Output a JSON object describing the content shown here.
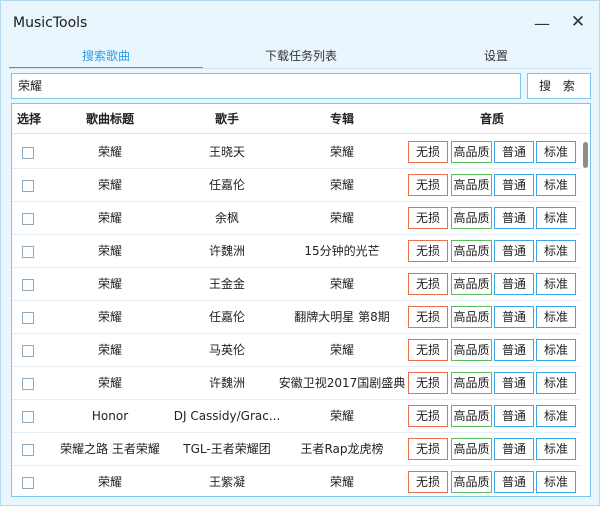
{
  "app": {
    "title": "MusicTools"
  },
  "window_controls": {
    "minimize": "—",
    "close": "✕"
  },
  "tabs": [
    {
      "label": "搜索歌曲"
    },
    {
      "label": "下载任务列表"
    },
    {
      "label": "设置"
    }
  ],
  "search": {
    "value": "荣耀",
    "button_label": "搜 索"
  },
  "columns": {
    "select": "选择",
    "title": "歌曲标题",
    "artist": "歌手",
    "album": "专辑",
    "quality": "音质"
  },
  "quality_labels": [
    "无损",
    "高品质",
    "普通",
    "标准"
  ],
  "rows": [
    {
      "title": "荣耀",
      "artist": "王晓天",
      "album": "荣耀"
    },
    {
      "title": "荣耀",
      "artist": "任嘉伦",
      "album": "荣耀"
    },
    {
      "title": "荣耀",
      "artist": "余枫",
      "album": "荣耀"
    },
    {
      "title": "荣耀",
      "artist": "许魏洲",
      "album": "15分钟的光芒"
    },
    {
      "title": "荣耀",
      "artist": "王金金",
      "album": "荣耀"
    },
    {
      "title": "荣耀",
      "artist": "任嘉伦",
      "album": "翻牌大明星 第8期"
    },
    {
      "title": "荣耀",
      "artist": "马英伦",
      "album": "荣耀"
    },
    {
      "title": "荣耀",
      "artist": "许魏洲",
      "album": "安徽卫视2017国剧盛典"
    },
    {
      "title": "Honor",
      "artist": "DJ Cassidy/Grac...",
      "album": "荣耀"
    },
    {
      "title": "荣耀之路 王者荣耀",
      "artist": "TGL-王者荣耀团",
      "album": "王者Rap龙虎榜"
    },
    {
      "title": "荣耀",
      "artist": "王紫凝",
      "album": "荣耀"
    }
  ],
  "colors": {
    "accent": "#2b9fe3",
    "lossless_border": "#e8704a",
    "hq_border": "#5bbd5b",
    "normal_border": "#3aa7e8"
  }
}
